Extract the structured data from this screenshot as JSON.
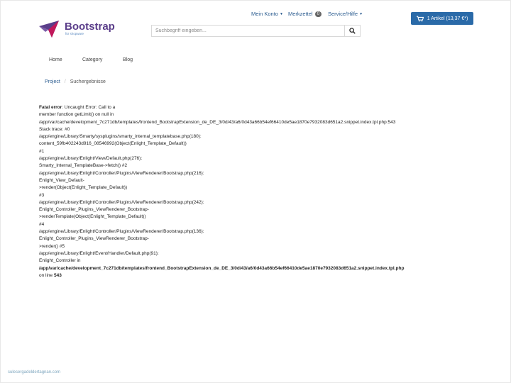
{
  "header": {
    "links": [
      {
        "label": "Mein Konto",
        "has_caret": true
      },
      {
        "label": "Merkzettel",
        "badge": "0"
      },
      {
        "label": "Service/Hilfe",
        "has_caret": true
      }
    ],
    "cart": {
      "label": "1 Artikel (13,37 €*)",
      "icon": "cart-icon"
    },
    "logo": {
      "title": "Bootstrap",
      "subtitle": "für shopware",
      "icon": "logo-mark-icon"
    },
    "search": {
      "placeholder": "Suchbegriff eingeben...",
      "value": "",
      "icon": "search-icon"
    }
  },
  "nav": {
    "items": [
      "Home",
      "Category",
      "Blog"
    ]
  },
  "breadcrumb": {
    "items": [
      "Project",
      "Suchergebnisse"
    ]
  },
  "error": {
    "label": "Fatal error",
    "lines": [
      {
        "prefix": "Fatal error",
        "text": ": Uncaught Error: Call to a"
      },
      {
        "text": "member function getLimit() on null in"
      },
      {
        "text": "/app/var/cache/development_7c271db/templates/frontend_BootstrapExtension_de_DE_3/0d/43/a6/0d43a66b54ef66410de5ae1870e7932083d651a2.snippet.index.tpl.php:543"
      },
      {
        "text": "Stack trace: #0"
      },
      {
        "text": "/app/engine/Library/Smarty/sysplugins/smarty_internal_templatebase.php(180):"
      },
      {
        "text": "content_59fb402243d916_08546992(Object(Enlight_Template_Default))"
      },
      {
        "text": "#1"
      },
      {
        "text": "/app/engine/Library/Enlight/View/Default.php(276):"
      },
      {
        "text": "Smarty_Internal_TemplateBase->fetch() #2"
      },
      {
        "text": "/app/engine/Library/Enlight/Controller/Plugins/ViewRenderer/Bootstrap.php(216):"
      },
      {
        "text": "Enlight_View_Default-"
      },
      {
        "text": ">render(Object(Enlight_Template_Default))"
      },
      {
        "text": "#3"
      },
      {
        "text": "/app/engine/Library/Enlight/Controller/Plugins/ViewRenderer/Bootstrap.php(242):"
      },
      {
        "text": "Enlight_Controller_Plugins_ViewRenderer_Bootstrap-"
      },
      {
        "text": ">renderTemplate(Object(Enlight_Template_Default))"
      },
      {
        "text": "#4"
      },
      {
        "text": "/app/engine/Library/Enlight/Controller/Plugins/ViewRenderer/Bootstrap.php(136):"
      },
      {
        "text": "Enlight_Controller_Plugins_ViewRenderer_Bootstrap-"
      },
      {
        "text": ">render() #5"
      },
      {
        "text": "/app/engine/Library/Enlight/Event/Handler/Default.php(91):"
      },
      {
        "text": "Enlight_Controller in"
      },
      {
        "bold": "/app/var/cache/development_7c271db/templates/frontend_BootstrapExtension_de_DE_3/0d/43/a6/0d43a66b54ef66410de5ae1870e7932083d651a2.snippet.index.tpl.php"
      },
      {
        "text": "on line ",
        "bold_suffix": "543"
      }
    ]
  },
  "watermark": "sulesergadeldertagnan.com",
  "colors": {
    "brand": "#5b3e8a",
    "link": "#2a5b8f",
    "button": "#2a6aa8"
  }
}
